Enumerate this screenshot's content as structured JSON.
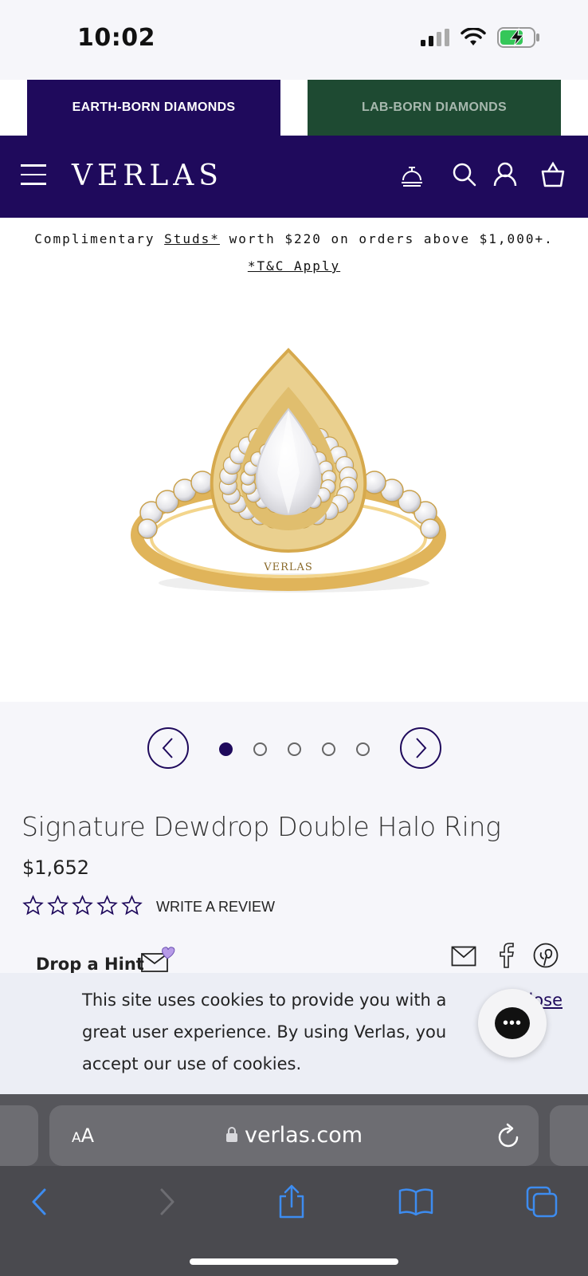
{
  "status_bar": {
    "time": "10:02"
  },
  "tabs": {
    "earth": "EARTH-BORN DIAMONDS",
    "lab": "LAB-BORN DIAMONDS"
  },
  "header": {
    "logo": "VERLAS"
  },
  "promo": {
    "prefix": "Complimentary ",
    "studs_link": "Studs*",
    "suffix": " worth $220 on orders above $1,000+.",
    "tc_link": "*T&C Apply"
  },
  "product_image": {
    "engraving": "VERLAS"
  },
  "carousel": {
    "total_slides": 5,
    "active_slide": 1
  },
  "product": {
    "title": "Signature Dewdrop Double Halo Ring",
    "price": "$1,652",
    "rating_stars": 5,
    "rating_value": 0,
    "review_label": "WRITE A REVIEW"
  },
  "share": {
    "hint_label": "Drop a Hint"
  },
  "cookie": {
    "text": "This site uses cookies to provide you with a great user experience. By using Verlas, you accept our use of cookies.",
    "close_label": "Close"
  },
  "browser": {
    "aa_label": "AA",
    "url": "verlas.com"
  },
  "colors": {
    "brand_purple": "#1f0a5c",
    "lab_green": "#1e4a32",
    "gold": "#e3b75a",
    "browser_blue": "#3d8cf0"
  }
}
